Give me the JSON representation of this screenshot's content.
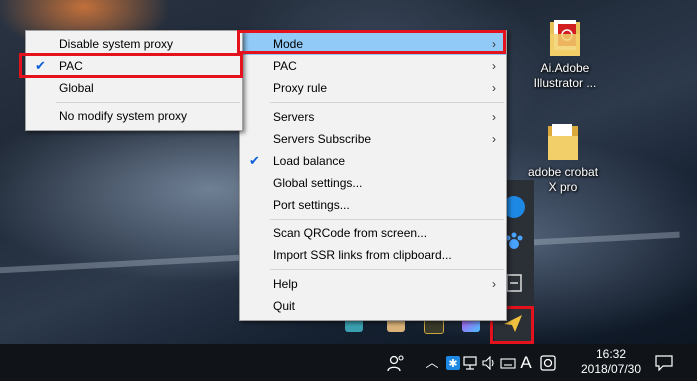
{
  "desktop_icons": [
    {
      "label": "Ai.Adobe Illustrator ...",
      "icon": "pdf-folder-icon"
    },
    {
      "label": "adobe crobat X pro",
      "icon": "folder-icon"
    }
  ],
  "mode_submenu": {
    "items": [
      {
        "label": "Disable system proxy",
        "checked": false
      },
      {
        "label": "PAC",
        "checked": true
      },
      {
        "label": "Global",
        "checked": false
      },
      {
        "label": "No modify system proxy",
        "checked": false
      }
    ]
  },
  "main_menu": {
    "items": [
      {
        "label": "Mode",
        "submenu": true,
        "highlighted": true
      },
      {
        "label": "PAC",
        "submenu": true
      },
      {
        "label": "Proxy rule",
        "submenu": true
      },
      {
        "label": "Servers",
        "submenu": true
      },
      {
        "label": "Servers Subscribe",
        "submenu": true
      },
      {
        "label": "Load balance",
        "checked": true
      },
      {
        "label": "Global settings..."
      },
      {
        "label": "Port settings..."
      },
      {
        "label": "Scan QRCode from screen..."
      },
      {
        "label": "Import SSR links from clipboard..."
      },
      {
        "label": "Help",
        "submenu": true
      },
      {
        "label": "Quit"
      }
    ]
  },
  "taskbar": {
    "time": "16:32",
    "date": "2018/07/30",
    "ime": "A"
  },
  "glyphs": {
    "arrow": "›",
    "check": "✔"
  },
  "colors": {
    "highlight": "#91c9f7",
    "annotation": "#e3121c",
    "menu_bg": "#f2f2f2"
  }
}
